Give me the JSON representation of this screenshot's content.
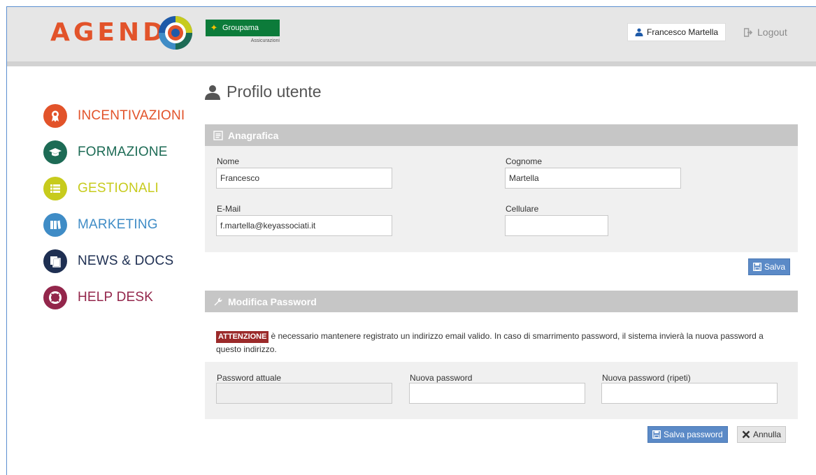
{
  "header": {
    "logo_text": "AGEND",
    "partner_name": "Groupama",
    "partner_sub": "Assicurazioni",
    "user_name": "Francesco Martella",
    "logout_label": "Logout"
  },
  "sidebar": {
    "items": [
      {
        "label": "INCENTIVAZIONI",
        "icon": "award-icon",
        "color": "#e2532a"
      },
      {
        "label": "FORMAZIONE",
        "icon": "graduation-cap-icon",
        "color": "#1d6b55"
      },
      {
        "label": "GESTIONALI",
        "icon": "list-icon",
        "color": "#c7cb1d"
      },
      {
        "label": "MARKETING",
        "icon": "book-icon",
        "color": "#3f8cc6"
      },
      {
        "label": "NEWS & DOCS",
        "icon": "documents-icon",
        "color": "#1e2f52"
      },
      {
        "label": "HELP DESK",
        "icon": "lifebuoy-icon",
        "color": "#93264b"
      }
    ]
  },
  "page": {
    "title": "Profilo utente"
  },
  "anagrafica": {
    "heading": "Anagrafica",
    "nome_label": "Nome",
    "nome_value": "Francesco",
    "cognome_label": "Cognome",
    "cognome_value": "Martella",
    "email_label": "E-Mail",
    "email_value": "f.martella@keyassociati.it",
    "cellulare_label": "Cellulare",
    "cellulare_value": "",
    "save_label": "Salva"
  },
  "password": {
    "heading": "Modifica Password",
    "warning_badge": "ATTENZIONE",
    "warning_text": "è necessario mantenere registrato un indirizzo email valido. In caso di smarrimento password, il sistema invierà la nuova password a questo indirizzo.",
    "current_label": "Password attuale",
    "new_label": "Nuova password",
    "repeat_label": "Nuova password (ripeti)",
    "save_label": "Salva password",
    "cancel_label": "Annulla"
  },
  "colors": {
    "brand_orange": "#e2532a",
    "primary_button": "#5b8ac7",
    "panel_header": "#c6c6c6",
    "warning_badge": "#9b2a2a"
  }
}
